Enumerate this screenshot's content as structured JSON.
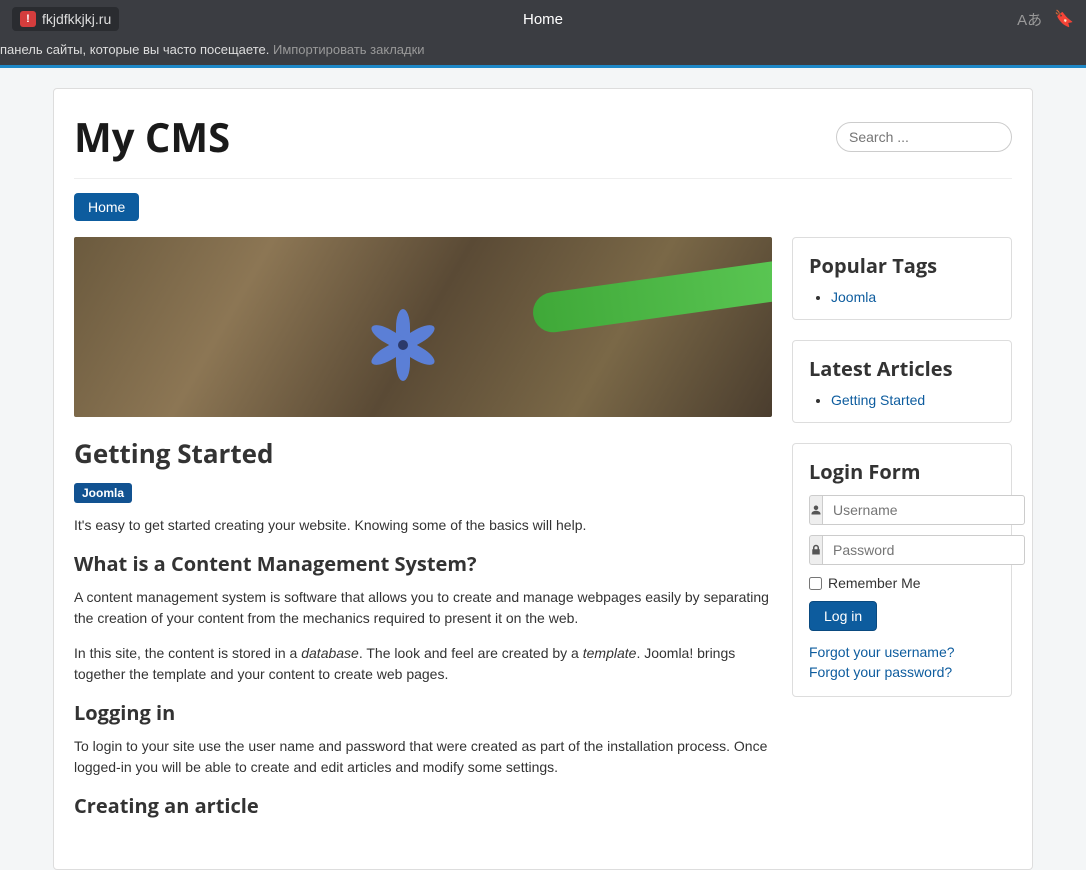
{
  "browser": {
    "url": "fkjdfkkjkj.ru",
    "tab_title": "Home",
    "bookmark_hint_prefix": "панель сайты, которые вы часто посещаете. ",
    "bookmark_import": "Импортировать закладки"
  },
  "header": {
    "site_title": "My CMS",
    "search_placeholder": "Search ..."
  },
  "nav": {
    "home": "Home"
  },
  "article": {
    "title": "Getting Started",
    "tag": "Joomla",
    "intro": "It's easy to get started creating your website. Knowing some of the basics will help.",
    "h_cms": "What is a Content Management System?",
    "p_cms": "A content management system is software that allows you to create and manage webpages easily by separating the creation of your content from the mechanics required to present it on the web.",
    "p_db_1": "In this site, the content is stored in a ",
    "p_db_em1": "database",
    "p_db_2": ". The look and feel are created by a ",
    "p_db_em2": "template",
    "p_db_3": ". Joomla! brings together the template and your content to create web pages.",
    "h_login": "Logging in",
    "p_login": "To login to your site use the user name and password that were created as part of the installation process. Once logged-in you will be able to create and edit articles and modify some settings.",
    "h_create": "Creating an article"
  },
  "sidebar": {
    "tags_title": "Popular Tags",
    "tag_item": "Joomla",
    "latest_title": "Latest Articles",
    "latest_item": "Getting Started",
    "login_title": "Login Form",
    "username_placeholder": "Username",
    "password_placeholder": "Password",
    "remember": "Remember Me",
    "login_btn": "Log in",
    "forgot_user": "Forgot your username?",
    "forgot_pass": "Forgot your password?"
  }
}
